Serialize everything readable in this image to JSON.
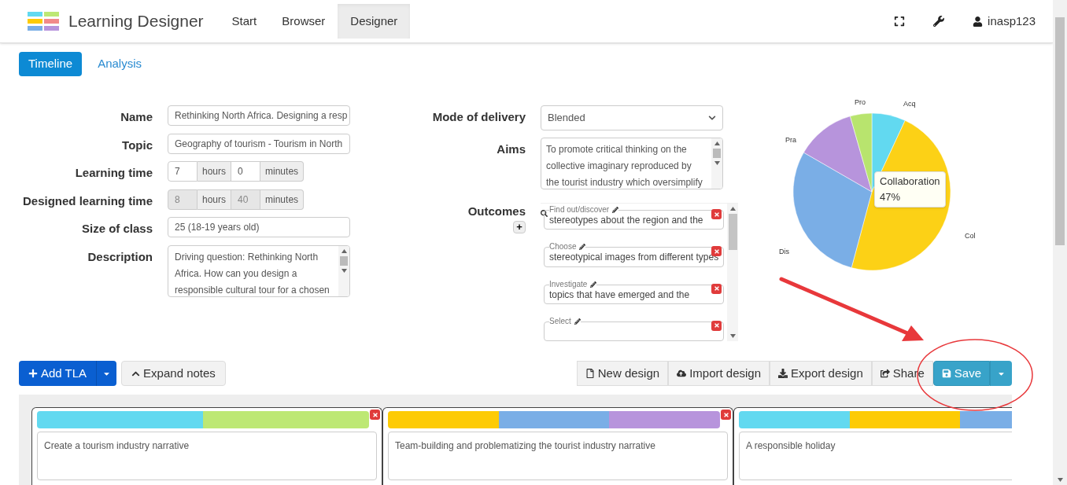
{
  "app": {
    "title": "Learning Designer"
  },
  "nav": [
    {
      "label": "Start",
      "selected": false
    },
    {
      "label": "Browser",
      "selected": false
    },
    {
      "label": "Designer",
      "selected": true
    }
  ],
  "user": {
    "name": "inasp123"
  },
  "view_tabs": [
    {
      "label": "Timeline",
      "selected": true
    },
    {
      "label": "Analysis",
      "selected": false
    }
  ],
  "fields": [
    {
      "kind": "text",
      "label": "Name",
      "value": "Rethinking North Africa. Designing a resp"
    },
    {
      "kind": "text",
      "label": "Topic",
      "value": "Geography of tourism - Tourism in North"
    },
    {
      "kind": "time",
      "label": "Learning time",
      "disabled": false,
      "hours": "7",
      "hours_unit": "hours",
      "minutes": "0",
      "minutes_unit": "minutes"
    },
    {
      "kind": "time",
      "label": "Designed learning time",
      "disabled": true,
      "hours": "8",
      "hours_unit": "hours",
      "minutes": "40",
      "minutes_unit": "minutes"
    },
    {
      "kind": "text",
      "label": "Size of class",
      "value": "25 (18-19 years old)"
    },
    {
      "kind": "area",
      "label": "Description",
      "value": "Driving question: Rethinking North Africa. How can you design a responsible cultural tour for a chosen"
    }
  ],
  "mode": {
    "label": "Mode of delivery",
    "value": "Blended"
  },
  "aims": {
    "label": "Aims",
    "value": "To promote critical thinking on the collective imaginary reproduced by the tourist industry which oversimplify"
  },
  "outcomes": {
    "label": "Outcomes",
    "add": "+",
    "items": [
      {
        "verb": "Find out/discover",
        "text": "stereotypes about the region and the"
      },
      {
        "verb": "Choose",
        "text": "stereotypical images from different types"
      },
      {
        "verb": "Investigate",
        "text": "topics that have emerged and the"
      },
      {
        "verb": "Select"
      }
    ]
  },
  "pie": {
    "labels": [
      {
        "text": "Acq",
        "color": "#62d9f0"
      },
      {
        "text": "Col",
        "color": "#fcd116"
      },
      {
        "text": "Dis",
        "color": "#7aaee6"
      },
      {
        "text": "Pra",
        "color": "#b794dc"
      },
      {
        "text": "Pro",
        "color": "#b8e46e"
      }
    ],
    "tooltip_title": "Collaboration",
    "tooltip_value": "47%"
  },
  "toolbar_left": [
    {
      "kind": "primary",
      "label": "Add TLA"
    },
    {
      "kind": "plain",
      "label": "Expand notes"
    }
  ],
  "toolbar_right": [
    {
      "kind": "new",
      "label": "New design"
    },
    {
      "kind": "import",
      "label": "Import design"
    },
    {
      "kind": "export",
      "label": "Export design"
    },
    {
      "kind": "share",
      "label": "Share"
    },
    {
      "kind": "save",
      "label": "Save"
    }
  ],
  "tlas": [
    {
      "title": "Create a tourism industry narrative",
      "segments": [
        {
          "color": "#62d9f0"
        },
        {
          "color": "#bde874"
        }
      ]
    },
    {
      "title": "Team-building and problematizing the tourist industry narrative",
      "segments": [
        {
          "color": "#fdcb05"
        },
        {
          "color": "#7aaee6"
        },
        {
          "color": "#b794dc"
        }
      ]
    },
    {
      "title": "A responsible holiday",
      "segments": [
        {
          "color": "#62d9f0"
        },
        {
          "color": "#fdcb05"
        },
        {
          "color": "#7aaee6"
        }
      ]
    }
  ]
}
